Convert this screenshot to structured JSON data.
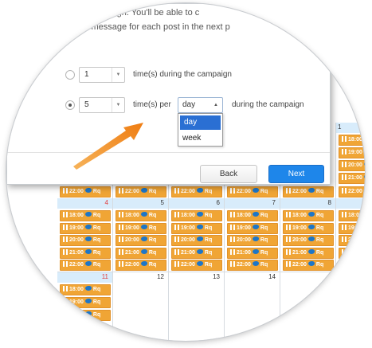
{
  "modal": {
    "intro_line1": "dule for your campaign. You'll be able to c",
    "intro_line2": "s customize the message for each post in the next p",
    "option1": {
      "value": "1",
      "text": "time(s) during the campaign"
    },
    "option2": {
      "value": "5",
      "text_before": "time(s) per",
      "text_after": "during the campaign"
    },
    "period_select": {
      "selected": "day",
      "options": [
        "day",
        "week"
      ]
    },
    "buttons": {
      "back": "Back",
      "next": "Next"
    }
  },
  "calendar": {
    "day_numbers": [
      "1",
      "4",
      "5",
      "6",
      "7",
      "8",
      "11",
      "12",
      "13",
      "14"
    ],
    "post_times_week1": [
      "18:00",
      "19:00",
      "20:00",
      "21:00",
      "22:00"
    ],
    "post_network_label": "Rq",
    "top_row_last_time": "22:00"
  },
  "colors": {
    "accent": "#1e86ea",
    "post_bg": "#f0a535",
    "header_bg": "#d8ecfb",
    "arrow": "#f28a1a",
    "sunday": "#e04040"
  }
}
